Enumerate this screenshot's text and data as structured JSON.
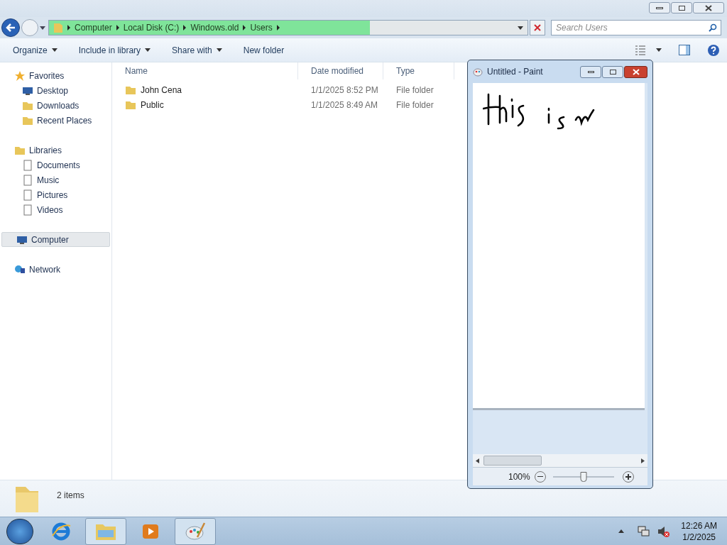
{
  "explorer": {
    "breadcrumb": [
      "Computer",
      "Local Disk (C:)",
      "Windows.old",
      "Users"
    ],
    "address_progress": {
      "level": 0.67
    },
    "search": {
      "placeholder": "Search Users"
    },
    "toolbar": [
      "Organize",
      "Include in library",
      "Share with",
      "New folder"
    ],
    "sidebar": [
      {
        "label": "Favorites",
        "kind": "group",
        "selected": false,
        "children": [
          {
            "label": "Desktop",
            "selected": false
          },
          {
            "label": "Downloads",
            "selected": false
          },
          {
            "label": "Recent Places",
            "selected": false
          }
        ]
      },
      {
        "label": "Libraries",
        "kind": "group",
        "selected": false,
        "children": [
          {
            "label": "Documents",
            "selected": false
          },
          {
            "label": "Music",
            "selected": false
          },
          {
            "label": "Pictures",
            "selected": false
          },
          {
            "label": "Videos",
            "selected": false
          }
        ]
      },
      {
        "label": "Computer",
        "kind": "group",
        "selected": true
      },
      {
        "label": "Network",
        "kind": "group",
        "selected": false
      }
    ],
    "columns": [
      "Name",
      "Date modified",
      "Type"
    ],
    "rows": [
      {
        "name": "John Cena",
        "date": "1/1/2025 8:52 PM",
        "type": "File folder"
      },
      {
        "name": "Public",
        "date": "1/1/2025 8:49 AM",
        "type": "File folder"
      }
    ],
    "status": "2 items"
  },
  "paint": {
    "title": "Untitled - Paint",
    "zoom_text": "100%",
    "zoom": {
      "level": 0.5
    }
  },
  "taskbar": {
    "time": "12:26 AM",
    "date": "1/2/2025"
  }
}
